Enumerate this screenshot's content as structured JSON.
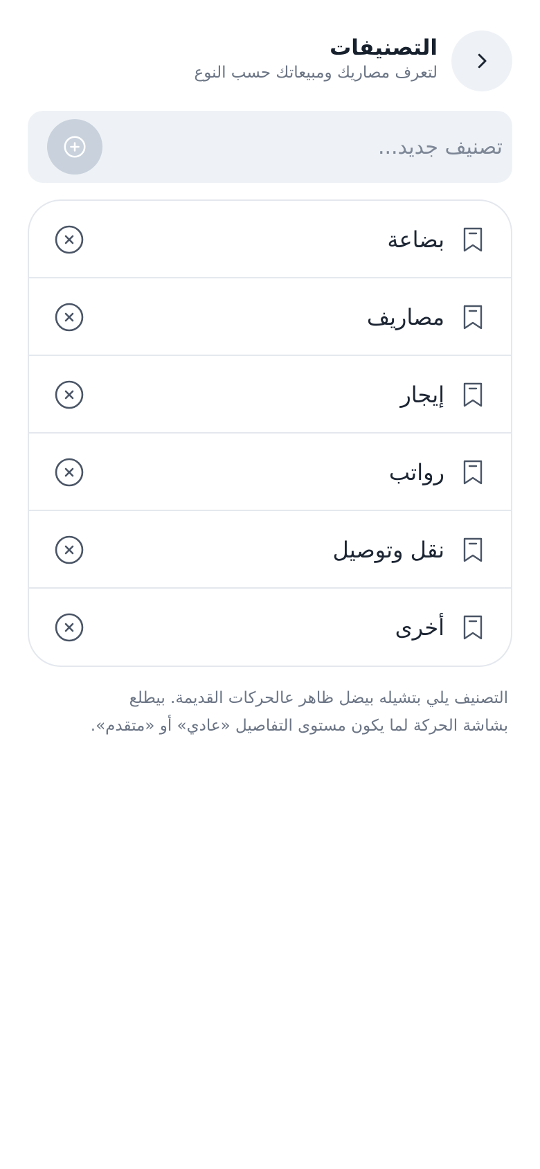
{
  "header": {
    "title": "التصنيفات",
    "subtitle": "لتعرف مصاريك ومبيعاتك حسب النوع",
    "back_icon": "chevron-right-icon"
  },
  "new_category": {
    "placeholder": "تصنيف جديد...",
    "value": "",
    "add_icon": "plus-circle-icon"
  },
  "categories": [
    {
      "label": "بضاعة",
      "icon": "bookmark-icon",
      "remove_icon": "x-circle-icon"
    },
    {
      "label": "مصاريف",
      "icon": "bookmark-icon",
      "remove_icon": "x-circle-icon"
    },
    {
      "label": "إيجار",
      "icon": "bookmark-icon",
      "remove_icon": "x-circle-icon"
    },
    {
      "label": "رواتب",
      "icon": "bookmark-icon",
      "remove_icon": "x-circle-icon"
    },
    {
      "label": "نقل وتوصيل",
      "icon": "bookmark-icon",
      "remove_icon": "x-circle-icon"
    },
    {
      "label": "أخرى",
      "icon": "bookmark-icon",
      "remove_icon": "x-circle-icon"
    }
  ],
  "note": {
    "line1": "التصنيف يلي بتشيله بيضل ظاهر عالحركات القديمة. بيطلع",
    "line2": "بشاشة الحركة لما يكون مستوى التفاصيل «عادي» أو «متقدم»."
  },
  "colors": {
    "text_primary": "#1c2533",
    "text_secondary": "#6b7585",
    "surface": "#eef2f6",
    "add_button": "#c8d1dc",
    "border": "#e4e8ee"
  }
}
